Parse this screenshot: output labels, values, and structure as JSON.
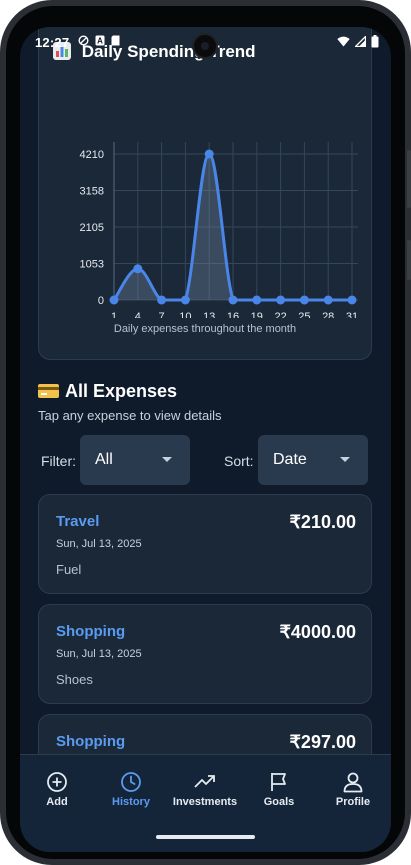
{
  "status_bar": {
    "time": "12:27"
  },
  "chart_card": {
    "title": "Daily Spending Trend",
    "caption": "Daily expenses throughout the month"
  },
  "chart_data": {
    "type": "area",
    "title": "Daily Spending Trend",
    "x": [
      1,
      4,
      7,
      10,
      13,
      16,
      19,
      22,
      25,
      28,
      31
    ],
    "values": [
      0,
      900,
      0,
      0,
      4210,
      0,
      0,
      0,
      0,
      0,
      0
    ],
    "y_ticks": [
      0,
      1053,
      2105,
      3158,
      4210
    ],
    "x_ticks": [
      1,
      4,
      7,
      10,
      13,
      16,
      19,
      22,
      25,
      28,
      31
    ],
    "ylim": [
      0,
      4210
    ],
    "grid": true,
    "line_color": "#4a86e8"
  },
  "expenses_section": {
    "icon": "credit-card-icon",
    "title": "All Expenses",
    "subtitle": "Tap any expense to view details"
  },
  "filters": {
    "filter_label": "Filter:",
    "filter_value": "All",
    "sort_label": "Sort:",
    "sort_value": "Date"
  },
  "expenses": [
    {
      "category": "Travel",
      "date": "Sun, Jul 13, 2025",
      "note": "Fuel",
      "amount": "₹210.00"
    },
    {
      "category": "Shopping",
      "date": "Sun, Jul 13, 2025",
      "note": "Shoes",
      "amount": "₹4000.00"
    },
    {
      "category": "Shopping",
      "date": "",
      "note": "",
      "amount": "₹297.00"
    }
  ],
  "bottom_nav": [
    {
      "label": "Add",
      "icon": "plus-circle-icon",
      "active": false
    },
    {
      "label": "History",
      "icon": "clock-icon",
      "active": true
    },
    {
      "label": "Investments",
      "icon": "trending-up-icon",
      "active": false
    },
    {
      "label": "Goals",
      "icon": "flag-icon",
      "active": false
    },
    {
      "label": "Profile",
      "icon": "person-icon",
      "active": false
    }
  ],
  "colors": {
    "accent": "#5b9bf0",
    "background": "#0f1b2b",
    "card": "#1b2838"
  }
}
